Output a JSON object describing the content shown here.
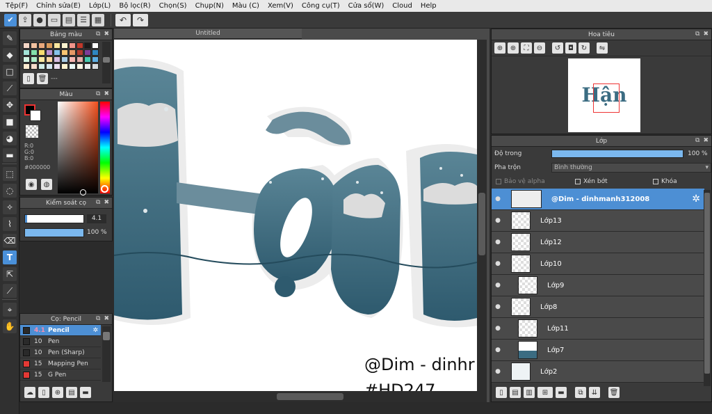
{
  "menu": [
    "Tệp(F)",
    "Chỉnh sửa(E)",
    "Lớp(L)",
    "Bộ lọc(R)",
    "Chọn(S)",
    "Chụp(N)",
    "Màu (C)",
    "Xem(V)",
    "Công cụ(T)",
    "Cửa sổ(W)",
    "Cloud",
    "Help"
  ],
  "panels": {
    "palette": {
      "title": "Bảng màu",
      "footer_text": "---"
    },
    "color": {
      "title": "Màu",
      "r": "R:0",
      "g": "G:0",
      "b": "B:0",
      "hex": "#000000"
    },
    "brush_control": {
      "title": "Kiểm soát cọ",
      "size": "4.1",
      "opacity": "100 %"
    },
    "brush_list": {
      "title": "Cọ: Pencil",
      "items": [
        {
          "size": "4.1",
          "name": "Pencil",
          "color": "#2a2a2a"
        },
        {
          "size": "10",
          "name": "Pen",
          "color": "#2a2a2a"
        },
        {
          "size": "10",
          "name": "Pen (Sharp)",
          "color": "#2a2a2a"
        },
        {
          "size": "15",
          "name": "Mapping Pen",
          "color": "#e53935"
        },
        {
          "size": "15",
          "name": "G Pen",
          "color": "#e53935"
        }
      ]
    },
    "navigator": {
      "title": "Hoa tiêu"
    },
    "layers": {
      "title": "Lớp",
      "opacity_label": "Độ trong",
      "opacity_value": "100 %",
      "blend_label": "Pha trộn",
      "blend_value": "Bình thường",
      "protect_alpha": "Bảo vệ alpha",
      "clipping": "Xén bớt",
      "lock": "Khóa",
      "items": [
        {
          "name": "@Dim - dinhmanh312008"
        },
        {
          "name": "Lớp13"
        },
        {
          "name": "Lớp12"
        },
        {
          "name": "Lớp10"
        },
        {
          "name": "Lớp9"
        },
        {
          "name": "Lớp8"
        },
        {
          "name": "Lớp11"
        },
        {
          "name": "Lớp7"
        },
        {
          "name": "Lớp2"
        }
      ]
    }
  },
  "canvas": {
    "tab_title": "Untitled",
    "watermark_line1": "@Dim - dinhr",
    "watermark_line2": "#HD247",
    "nav_preview_text": "Hận"
  },
  "colors": {
    "accent": "#4d8fd4",
    "letter": "#3b6c82",
    "letter_dark": "#2e5a6e",
    "snow": "#e6e6e6"
  }
}
